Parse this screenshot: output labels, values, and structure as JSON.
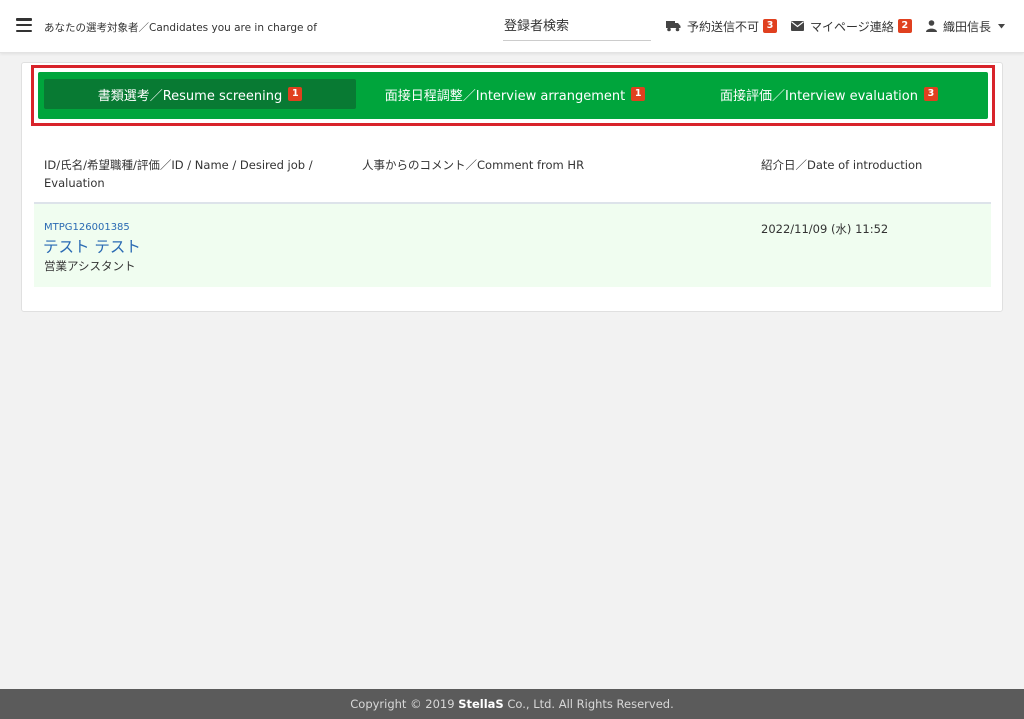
{
  "header": {
    "page_title": "あなたの選考対象者／Candidates you are in charge of",
    "search_placeholder": "登録者検索",
    "notifications": [
      {
        "label": "予約送信不可",
        "count": "3",
        "icon": "truck-icon"
      },
      {
        "label": "マイページ連絡",
        "count": "2",
        "icon": "envelope-icon"
      }
    ],
    "user": {
      "name": "織田信長",
      "icon": "user-icon"
    }
  },
  "tabs": [
    {
      "label": "書類選考／Resume screening",
      "count": "1",
      "active": true
    },
    {
      "label": "面接日程調整／Interview arrangement",
      "count": "1",
      "active": false
    },
    {
      "label": "面接評価／Interview evaluation",
      "count": "3",
      "active": false
    }
  ],
  "table": {
    "columns": [
      "ID/氏名/希望職種/評価／ID / Name / Desired job / Evaluation",
      "人事からのコメント／Comment from HR",
      "紹介日／Date of introduction"
    ],
    "rows": [
      {
        "id": "MTPG126001385",
        "name": "テスト テスト",
        "job": "営業アシスタント",
        "comment": "",
        "date": "2022/11/09 (水) 11:52"
      }
    ]
  },
  "footer": {
    "copyright_prefix": "Copyright © 2019 ",
    "company": "StellaS",
    "copyright_suffix": " Co., Ltd. All Rights Reserved."
  },
  "colors": {
    "tab_bar": "#00a53c",
    "tab_active": "#087a33",
    "badge": "#e0401f",
    "highlight_border": "#d8232a",
    "link": "#2a6ab3",
    "row_bg": "#f0fdf0",
    "footer_bg": "#5b5b5b"
  }
}
